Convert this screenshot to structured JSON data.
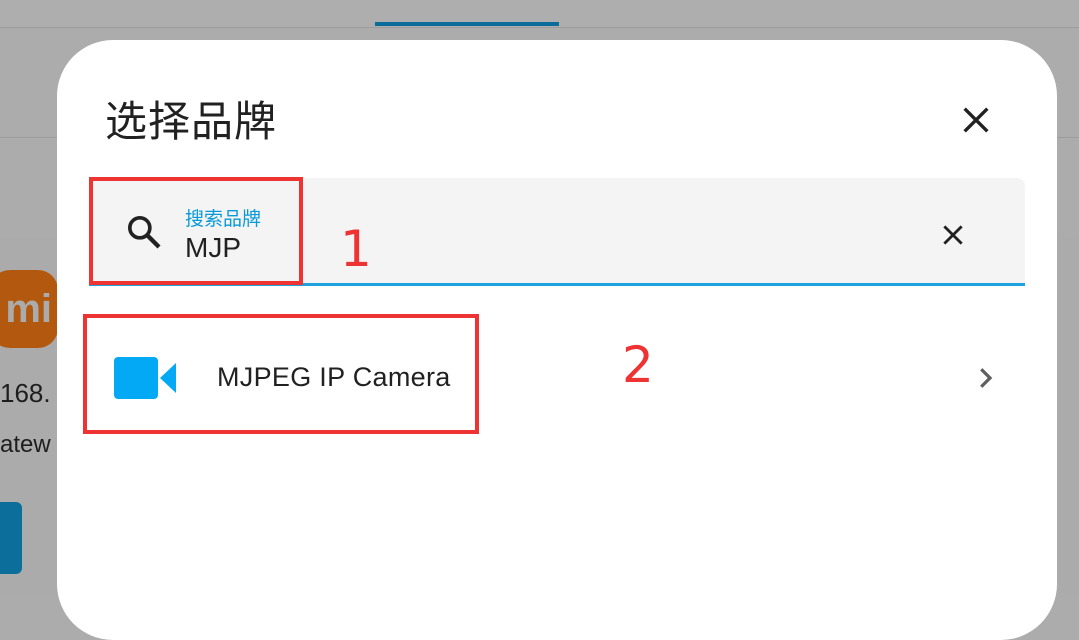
{
  "background": {
    "ip_fragment": "168.",
    "gateway_fragment": "atew",
    "logo_text": "mi"
  },
  "dialog": {
    "title": "选择品牌",
    "close_icon": "close-icon"
  },
  "search": {
    "label": "搜索品牌",
    "value": "MJP",
    "search_icon": "search-icon",
    "clear_icon": "clear-icon"
  },
  "results": [
    {
      "label": "MJPEG IP Camera",
      "icon": "video-camera-icon",
      "trailing_icon": "chevron-right-icon"
    }
  ],
  "annotations": [
    {
      "number": "1"
    },
    {
      "number": "2"
    }
  ],
  "colors": {
    "accent": "#1fa3e0",
    "annotation": "#ee3333",
    "camera_icon": "#03a9f4",
    "scrim": "#acacac"
  }
}
